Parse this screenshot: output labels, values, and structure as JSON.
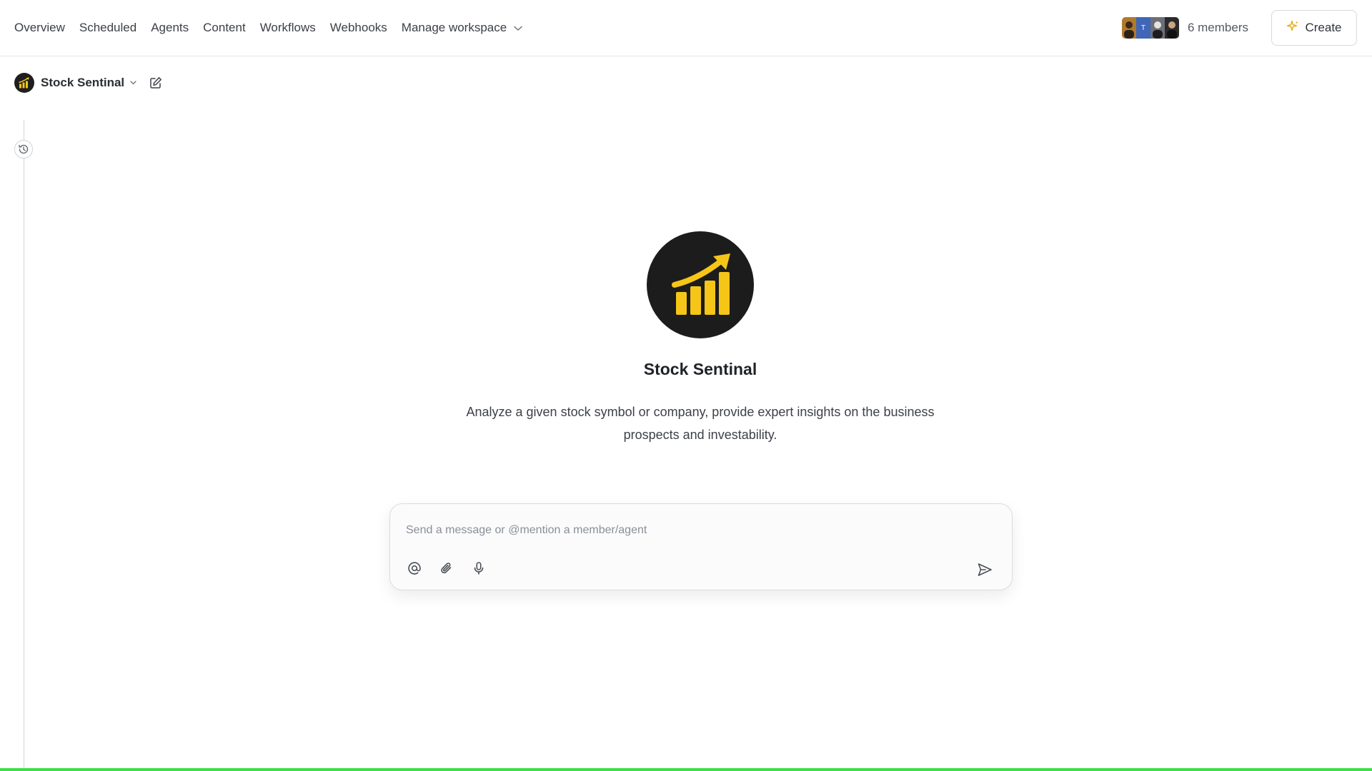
{
  "nav": {
    "items": [
      {
        "id": "overview",
        "label": "Overview"
      },
      {
        "id": "scheduled",
        "label": "Scheduled"
      },
      {
        "id": "agents",
        "label": "Agents"
      },
      {
        "id": "content",
        "label": "Content"
      },
      {
        "id": "workflows",
        "label": "Workflows"
      },
      {
        "id": "webhooks",
        "label": "Webhooks"
      },
      {
        "id": "manage-workspace",
        "label": "Manage workspace"
      }
    ]
  },
  "members": {
    "label": "6 members",
    "avatars": [
      {
        "initial": "",
        "color": "#b07a2c"
      },
      {
        "initial": "T",
        "color": "#3f66b7"
      },
      {
        "initial": "",
        "color": "#6b6f78"
      },
      {
        "initial": "",
        "color": "#2a2a2a"
      }
    ]
  },
  "create_button": {
    "label": "Create"
  },
  "agent": {
    "name": "Stock Sentinal",
    "title": "Stock Sentinal",
    "description": "Analyze a given stock symbol or company, provide expert insights on the business prospects and investability."
  },
  "composer": {
    "placeholder": "Send a message or @mention a member/agent",
    "value": ""
  },
  "colors": {
    "accent_yellow": "#f5c518",
    "logo_bg": "#1c1c1c",
    "progress_bar": "#3ee04a"
  },
  "icons": {
    "manage_caret": "chevron-down-icon",
    "create": "sparkle-icon",
    "agent_caret": "chevron-down-icon",
    "edit": "edit-icon",
    "history": "history-icon",
    "mention": "at-icon",
    "attach": "paperclip-icon",
    "mic": "microphone-icon",
    "send": "send-icon"
  }
}
